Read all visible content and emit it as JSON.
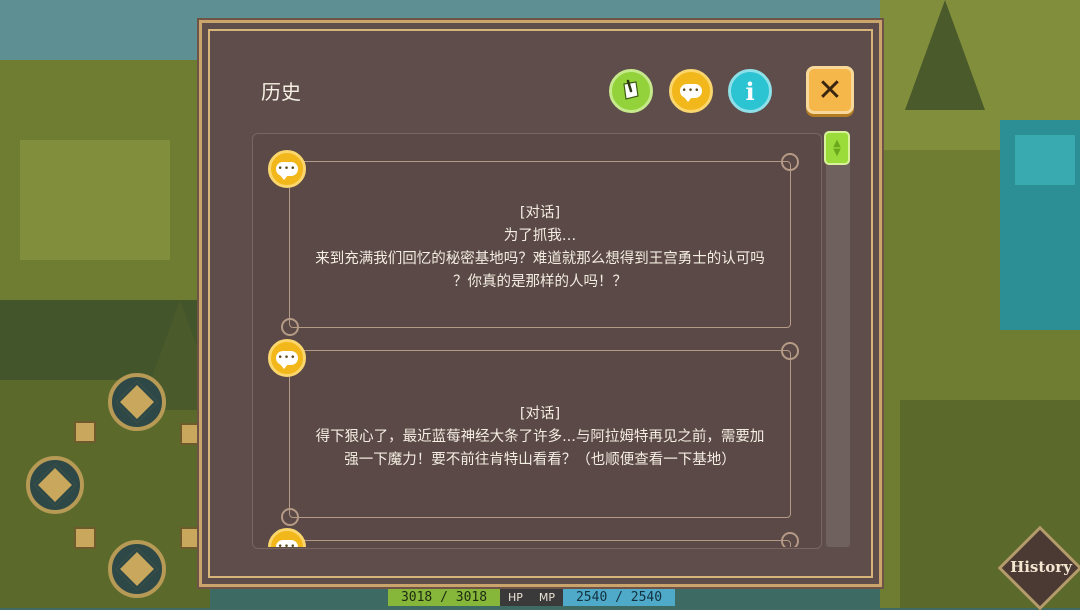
{
  "dialog": {
    "title": "历史",
    "icons": {
      "note": "note-icon",
      "chat": "chat-icon",
      "info": "i",
      "close": "✕"
    }
  },
  "entries": [
    {
      "tag": "[对话]",
      "lines": [
        "为了抓我…",
        "来到充满我们回忆的秘密基地吗？难道就那么想得到王宫勇士的认可吗",
        "？你真的是那样的人吗！？"
      ]
    },
    {
      "tag": "[对话]",
      "lines": [
        "得下狠心了，最近蓝莓神经大条了许多...与阿拉姆特再见之前，需要加",
        "强一下魔力！要不前往肯特山看看？（也顺便查看一下基地）"
      ]
    }
  ],
  "hud": {
    "hp_value": "3018 / 3018",
    "hp_label": "HP",
    "mp_label": "MP",
    "mp_value": "2540 / 2540"
  },
  "history_button": "History",
  "colors": {
    "accent": "#f2b81b",
    "panel": "#5e4d4a",
    "border": "#caa46a"
  }
}
